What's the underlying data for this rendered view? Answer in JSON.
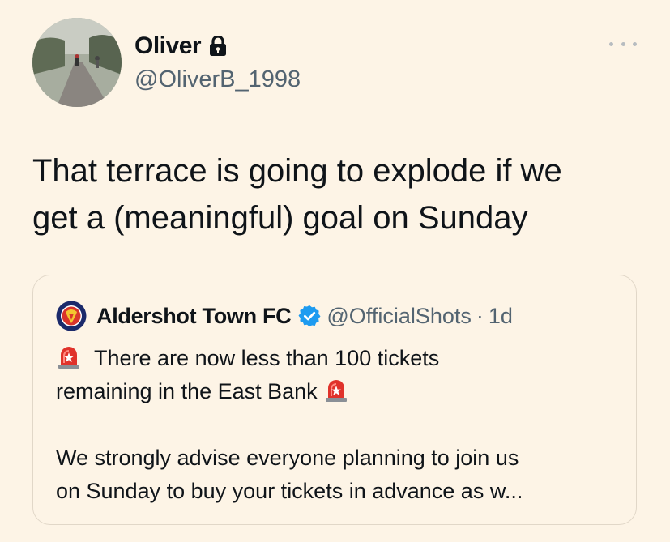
{
  "tweet": {
    "author": {
      "display_name": "Oliver",
      "handle": "@OliverB_1998",
      "protected": true
    },
    "text_lines": [
      "That terrace is going to explode if we",
      "get a (meaningful) goal on Sunday"
    ]
  },
  "quoted_tweet": {
    "author": {
      "display_name": "Aldershot Town FC",
      "handle": "@OfficialShots",
      "verified": true
    },
    "separator": "·",
    "time": "1d",
    "line1": "There are now less than 100 tickets",
    "line2": "remaining in the East Bank",
    "line3": "We strongly advise everyone planning to join us",
    "line4": "on Sunday to buy your tickets in advance as w..."
  },
  "icons": [
    "lock-icon",
    "more-icon",
    "verified-badge-icon",
    "siren-icon"
  ],
  "colors": {
    "background": "#fdf4e6",
    "text": "#0f1419",
    "secondary": "#536471",
    "verified": "#1d9bf0",
    "border": "#e1d7c8"
  }
}
